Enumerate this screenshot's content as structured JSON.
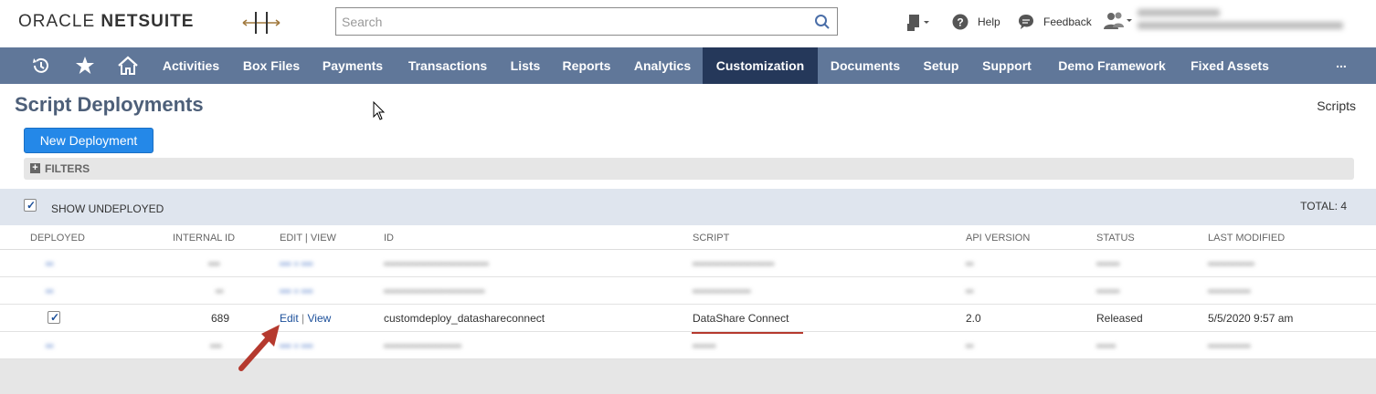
{
  "header": {
    "logo_part1": "ORACLE",
    "logo_part2": "NETSUITE",
    "search_placeholder": "Search",
    "help_label": "Help",
    "feedback_label": "Feedback"
  },
  "nav": {
    "items": [
      "Activities",
      "Box Files",
      "Payments",
      "Transactions",
      "Lists",
      "Reports",
      "Analytics",
      "Customization",
      "Documents",
      "Setup",
      "Support",
      "Demo Framework",
      "Fixed Assets"
    ],
    "active": "Customization",
    "more": "..."
  },
  "page": {
    "title": "Script Deployments",
    "scripts_link": "Scripts",
    "new_button": "New Deployment",
    "filters_label": "FILTERS",
    "show_undeployed_label": "SHOW UNDEPLOYED",
    "total": "TOTAL: 4"
  },
  "table": {
    "columns": [
      "DEPLOYED",
      "INTERNAL ID",
      "EDIT | VIEW",
      "ID",
      "SCRIPT",
      "API VERSION",
      "STATUS",
      "LAST MODIFIED"
    ],
    "rows": [
      {
        "internal_id": "689",
        "edit": "Edit",
        "view": "View",
        "id": "customdeploy_datashareconnect",
        "script": "DataShare Connect",
        "api_version": "2.0",
        "status": "Released",
        "last_modified": "5/5/2020 9:57 am"
      }
    ]
  },
  "colors": {
    "nav_bg": "#607799",
    "nav_active": "#25385a",
    "button_blue": "#2488e8",
    "annotation_red": "#b5392e"
  }
}
